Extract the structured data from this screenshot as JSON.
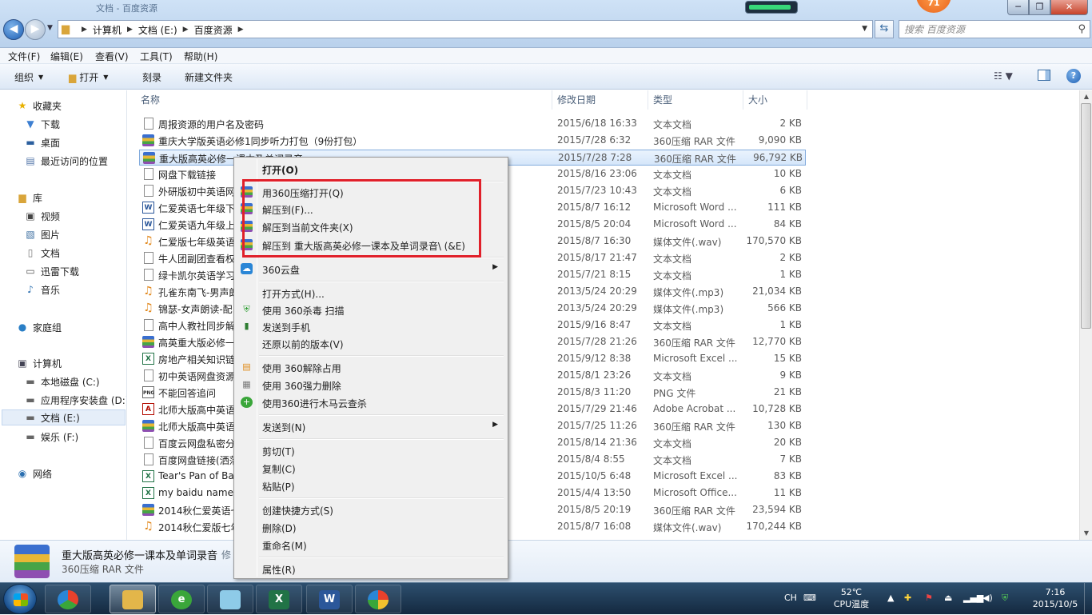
{
  "window": {
    "title": "文档 - 百度资源"
  },
  "address": {
    "crumbs": [
      "计算机",
      "文档 (E:)",
      "百度资源"
    ],
    "search_placeholder": "搜索 百度资源"
  },
  "balloon": {
    "text": "71"
  },
  "tray_progress": {
    "fill_fraction": 0.9
  },
  "menubar": [
    "文件(F)",
    "编辑(E)",
    "查看(V)",
    "工具(T)",
    "帮助(H)"
  ],
  "commandbar": {
    "organize": "组织",
    "open": "打开",
    "burn": "刻录",
    "new_folder": "新建文件夹"
  },
  "nav": {
    "favorites": "收藏夹",
    "downloads": "下载",
    "desktop": "桌面",
    "recent": "最近访问的位置",
    "libraries": "库",
    "videos": "视频",
    "pictures": "图片",
    "documents": "文档",
    "thunder": "迅雷下载",
    "music": "音乐",
    "homegroup": "家庭组",
    "computer": "计算机",
    "drive_c": "本地磁盘 (C:)",
    "drive_d": "应用程序安装盘 (D:)",
    "drive_e": "文档 (E:)",
    "drive_f": "娱乐 (F:)",
    "network": "网络"
  },
  "columns": {
    "name": "名称",
    "date": "修改日期",
    "type": "类型",
    "size": "大小"
  },
  "files": [
    {
      "name": "周报资源的用户名及密码",
      "date": "2015/6/18 16:33",
      "type": "文本文档",
      "size": "2 KB",
      "icon": "txt"
    },
    {
      "name": "重庆大学版英语必修1同步听力打包（9份打包）",
      "date": "2015/7/28 6:32",
      "type": "360压缩 RAR 文件",
      "size": "9,090 KB",
      "icon": "rar"
    },
    {
      "name": "重大版高英必修一课本及单词录音",
      "date": "2015/7/28 7:28",
      "type": "360压缩 RAR 文件",
      "size": "96,792 KB",
      "icon": "rar"
    },
    {
      "name": "网盘下载链接",
      "date": "2015/8/16 23:06",
      "type": "文本文档",
      "size": "10 KB",
      "icon": "txt"
    },
    {
      "name": "外研版初中英语网",
      "date": "2015/7/23 10:43",
      "type": "文本文档",
      "size": "6 KB",
      "icon": "txt"
    },
    {
      "name": "仁爱英语七年级下",
      "date": "2015/8/7 16:12",
      "type": "Microsoft Word ...",
      "size": "111 KB",
      "icon": "word"
    },
    {
      "name": "仁爱英语九年级上",
      "date": "2015/8/5 20:04",
      "type": "Microsoft Word ...",
      "size": "84 KB",
      "icon": "word"
    },
    {
      "name": "仁爱版七年级英语",
      "date": "2015/8/7 16:30",
      "type": "媒体文件(.wav)",
      "size": "170,570 KB",
      "icon": "wav"
    },
    {
      "name": "牛人团副团查看权",
      "date": "2015/8/17 21:47",
      "type": "文本文档",
      "size": "2 KB",
      "icon": "txt"
    },
    {
      "name": "绿卡凯尔英语学习",
      "date": "2015/7/21 8:15",
      "type": "文本文档",
      "size": "1 KB",
      "icon": "txt"
    },
    {
      "name": "孔雀东南飞-男声朗",
      "date": "2013/5/24 20:29",
      "type": "媒体文件(.mp3)",
      "size": "21,034 KB",
      "icon": "wav"
    },
    {
      "name": "锦瑟-女声朗读-配",
      "date": "2013/5/24 20:29",
      "type": "媒体文件(.mp3)",
      "size": "566 KB",
      "icon": "wav"
    },
    {
      "name": "高中人教社同步解",
      "date": "2015/9/16 8:47",
      "type": "文本文档",
      "size": "1 KB",
      "icon": "txt"
    },
    {
      "name": "高英重大版必修一",
      "date": "2015/7/28 21:26",
      "type": "360压缩 RAR 文件",
      "size": "12,770 KB",
      "icon": "rar"
    },
    {
      "name": "房地产相关知识链",
      "date": "2015/9/12 8:38",
      "type": "Microsoft Excel ...",
      "size": "15 KB",
      "icon": "excel"
    },
    {
      "name": "初中英语网盘资源",
      "date": "2015/8/1 23:26",
      "type": "文本文档",
      "size": "9 KB",
      "icon": "txt"
    },
    {
      "name": "不能回答追问",
      "date": "2015/8/3 11:20",
      "type": "PNG 文件",
      "size": "21 KB",
      "icon": "png"
    },
    {
      "name": "北师大版高中英语",
      "date": "2015/7/29 21:46",
      "type": "Adobe Acrobat ...",
      "size": "10,728 KB",
      "icon": "pdf"
    },
    {
      "name": "北师大版高中英语",
      "date": "2015/7/25 11:26",
      "type": "360压缩 RAR 文件",
      "size": "130 KB",
      "icon": "rar"
    },
    {
      "name": "百度云网盘私密分",
      "date": "2015/8/14 21:36",
      "type": "文本文档",
      "size": "20 KB",
      "icon": "txt"
    },
    {
      "name": "百度网盘链接(洒落",
      "date": "2015/8/4 8:55",
      "type": "文本文档",
      "size": "7 KB",
      "icon": "txt"
    },
    {
      "name": "Tear's Pan of Ba",
      "date": "2015/10/5 6:48",
      "type": "Microsoft Excel ...",
      "size": "83 KB",
      "icon": "excel"
    },
    {
      "name": "my baidu names",
      "date": "2015/4/4 13:50",
      "type": "Microsoft Office...",
      "size": "11 KB",
      "icon": "excel"
    },
    {
      "name": "2014秋仁爱英语七",
      "date": "2015/8/5 20:19",
      "type": "360压缩 RAR 文件",
      "size": "23,594 KB",
      "icon": "rar"
    },
    {
      "name": "2014秋仁爱版七年",
      "date": "2015/8/7 16:08",
      "type": "媒体文件(.wav)",
      "size": "170,244 KB",
      "icon": "wav"
    }
  ],
  "details": {
    "name": "重大版高英必修一课本及单词录音",
    "modified_label": "修",
    "type": "360压缩 RAR 文件"
  },
  "context_menu": {
    "open": "打开(O)",
    "open_360": "用360压缩打开(Q)",
    "extract_to": "解压到(F)...",
    "extract_here": "解压到当前文件夹(X)",
    "extract_named": "解压到 重大版高英必修一课本及单词录音\\ (&E)",
    "cloud": "360云盘",
    "open_with": "打开方式(H)...",
    "scan_360": "使用 360杀毒 扫描",
    "send_phone": "发送到手机",
    "restore": "还原以前的版本(V)",
    "unlock_360": "使用 360解除占用",
    "force_delete": "使用 360强力删除",
    "trojan_scan": "使用360进行木马云查杀",
    "send_to": "发送到(N)",
    "cut": "剪切(T)",
    "copy": "复制(C)",
    "paste": "粘贴(P)",
    "shortcut": "创建快捷方式(S)",
    "delete": "删除(D)",
    "rename": "重命名(M)",
    "properties": "属性(R)"
  },
  "taskbar": {
    "lang": "CH",
    "temp": "52℃",
    "temp_label": "CPU温度",
    "time": "7:16",
    "date": "2015/10/5"
  },
  "colors": {
    "highlight_box": "#e0202a",
    "selection": "#d5e6fa",
    "taskbar": "#1e3a56"
  }
}
